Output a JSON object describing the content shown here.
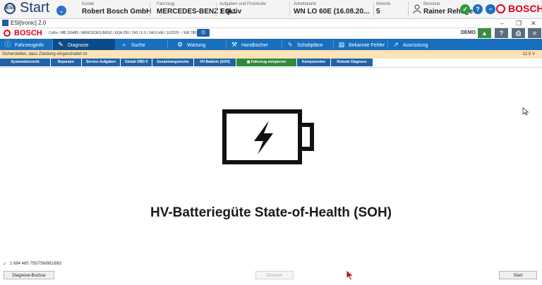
{
  "topbar": {
    "start_label": "Start",
    "start_badge": "ESI",
    "kunde_label": "Kunde",
    "kunde_value": "Robert Bosch GmbH",
    "fahrzeug_label": "Fahrzeug",
    "fahrzeug_value": "MERCEDES-BENZ EQ...",
    "aufgaben_label": "Aufgaben und Protokolle",
    "aufgaben_value": "1 aktiv",
    "arbeitskarte_label": "Arbeitskarte",
    "arbeitskarte_value": "WN LO 60E (16.08.20...",
    "historie_label": "Historie",
    "historie_value": "5",
    "benutzer_label": "Benutzer",
    "benutzer_value": "Rainer Rehage",
    "brand": "BOSCH"
  },
  "window": {
    "title": "ESI[tronic] 2.0",
    "minimize": "–",
    "restore": "❐",
    "close": "✕"
  },
  "header": {
    "brand": "BOSCH",
    "vehicle_info": "CoRe / MB 118485 / MERCEDES-BENZ / EQA 250 / 243 / 6.0 / 140.0 kW / 11/2020 - / EM 780.200",
    "demo": "DEMO"
  },
  "mainnav": {
    "items": [
      {
        "label": "Fahrzeuginfo",
        "icon": "info-icon"
      },
      {
        "label": "Diagnose",
        "icon": "diagnose-icon"
      },
      {
        "label": "Suche",
        "icon": "search-icon"
      },
      {
        "label": "Wartung",
        "icon": "gear-icon"
      },
      {
        "label": "Handbücher",
        "icon": "wrench-icon"
      },
      {
        "label": "Schaltpläne",
        "icon": "lightning-icon"
      },
      {
        "label": "Bekannte Fehler",
        "icon": "document-icon"
      },
      {
        "label": "Ausrüstung",
        "icon": "external-icon"
      }
    ]
  },
  "status": {
    "message": "Sicherstellen, dass Zündung eingeschaltet ist",
    "voltage": "12.5 V"
  },
  "subnav": {
    "tabs": [
      "Systemübersicht",
      "Reparatur",
      "Service Aufgaben",
      "Global OBD II",
      "Gesamtwegstrecke",
      "HV-Batterie (SOH)",
      "Fahrzeug entsperren",
      "Komponenten",
      "Remote Diagnose"
    ]
  },
  "content": {
    "heading": "HV-Batteriegüte State-of-Health (SOH)",
    "graphic": "battery-icon"
  },
  "footer": {
    "path": "1 684 465 755/756/881/882",
    "diagnose_button": "Diagnose-Buchse",
    "middle_button": "Drucken",
    "start_button": "Start"
  },
  "colors": {
    "nav_blue": "#1a6fbd",
    "nav_active": "#0d4b86",
    "status_bar": "#fde3b5",
    "bosch_red": "#e2001a",
    "tab_active_green": "#2e8b3d"
  }
}
